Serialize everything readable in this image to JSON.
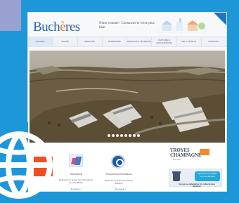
{
  "site": {
    "logo_main": "Buch",
    "logo_accent": "è",
    "logo_tail": "res",
    "tagline": "Notre volonté : Construire et vivre plus bien",
    "nav": [
      "Accueil",
      "Mairie",
      "Services",
      "Patrimoine",
      "Enfance & Jeunesse",
      "Culture & Associations",
      "Vie & Sports",
      "Finances"
    ]
  },
  "hero": {
    "dot_count": 8
  },
  "bottom": {
    "col1_title": "Informations",
    "col1_text": "Retrouvez ici toutes les informations de votre Mairie",
    "col2_title": "Recevoir les informations",
    "col2_text": "Abonnez-vous à notre liste de diffusion",
    "more_label": "En savoir +",
    "brand_line1": "TROYES",
    "brand_line2": "CHAMPAGNE",
    "brand_sub": "Métropole",
    "notify_cloud": "Recevez une alerte sur vos déchets",
    "notify_text": "Soyez au calendrier tri collecte des déchets"
  },
  "colors": {
    "accent_blue": "#1d97d8",
    "brand_blue": "#2a66ad",
    "orange": "#e7772a"
  }
}
